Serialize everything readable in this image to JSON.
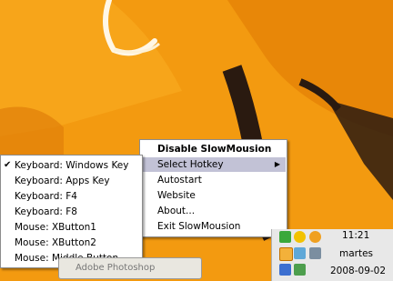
{
  "context_menu": {
    "items": [
      {
        "label": "Disable SlowMousion",
        "bold": true
      },
      {
        "label": "Select Hotkey",
        "highlighted": true,
        "has_submenu": true
      },
      {
        "label": "Autostart"
      },
      {
        "label": "Website"
      },
      {
        "label": "About..."
      },
      {
        "label": "Exit SlowMousion"
      }
    ]
  },
  "hotkey_submenu": {
    "items": [
      {
        "label": "Keyboard: Windows Key",
        "checked": true
      },
      {
        "label": "Keyboard: Apps Key"
      },
      {
        "label": "Keyboard: F4"
      },
      {
        "label": "Keyboard: F8"
      },
      {
        "label": "Mouse: XButton1"
      },
      {
        "label": "Mouse: XButton2"
      },
      {
        "label": "Mouse: Middle Button"
      }
    ]
  },
  "taskbar": {
    "button_label": "Adobe Photoshop",
    "clock": {
      "time": "11:21",
      "day": "martes",
      "date": "2008-09-02"
    }
  },
  "colors": {
    "wallpaper_orange": "#f39a10",
    "menu_highlight": "#c2c2d6"
  },
  "tray_icons": [
    "check-icon",
    "warning-shield-icon",
    "balloon-icon",
    "clock-icon",
    "network-icon",
    "tools-icon",
    "network-disabled-icon",
    "app-icon"
  ]
}
